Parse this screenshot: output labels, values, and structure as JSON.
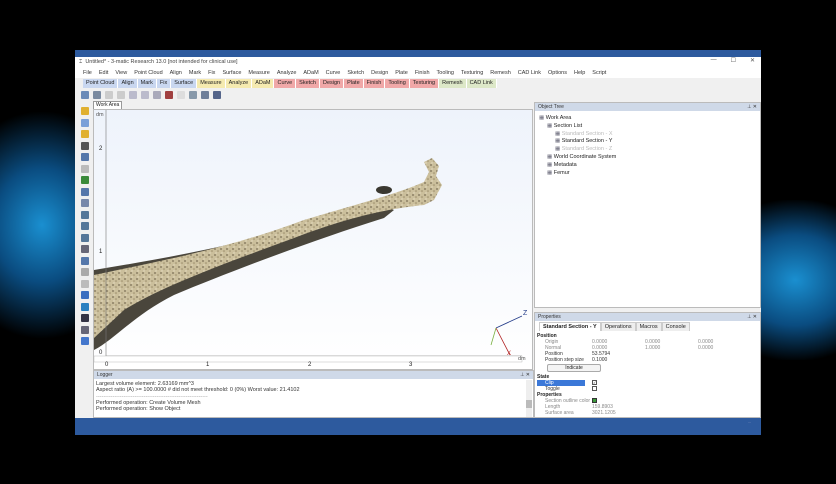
{
  "window": {
    "title": "Untitled* - 3-matic Research 13.0  [not intended for clinical use]",
    "controls": [
      "—",
      "☐",
      "✕"
    ]
  },
  "menu": [
    "File",
    "Edit",
    "View",
    "Point Cloud",
    "Align",
    "Mark",
    "Fix",
    "Surface",
    "Measure",
    "Analyze",
    "ADaM",
    "Curve",
    "Sketch",
    "Design",
    "Plate",
    "Finish",
    "Tooling",
    "Texturing",
    "Remesh",
    "CAD Link",
    "Options",
    "Help",
    "Script"
  ],
  "toolbar_tabs": [
    {
      "label": "Point Cloud",
      "color": "#c9d7f0"
    },
    {
      "label": "Align",
      "color": "#c9d7f0"
    },
    {
      "label": "Mark",
      "color": "#c9d7f0"
    },
    {
      "label": "Fix",
      "color": "#c9d7f0"
    },
    {
      "label": "Surface",
      "color": "#c9d7f0"
    },
    {
      "label": "Measure",
      "color": "#f5eab0"
    },
    {
      "label": "Analyze",
      "color": "#f5eab0"
    },
    {
      "label": "ADaM",
      "color": "#f5eab0"
    },
    {
      "label": "Curve",
      "color": "#f0a8a8"
    },
    {
      "label": "Sketch",
      "color": "#f0a8a8"
    },
    {
      "label": "Design",
      "color": "#f0a8a8"
    },
    {
      "label": "Plate",
      "color": "#f0a8a8"
    },
    {
      "label": "Finish",
      "color": "#f0a8a8"
    },
    {
      "label": "Tooling",
      "color": "#f0a8a8"
    },
    {
      "label": "Texturing",
      "color": "#f0a8a8"
    },
    {
      "label": "Remesh",
      "color": "#dde8c8"
    },
    {
      "label": "CAD Link",
      "color": "#dde8c8"
    }
  ],
  "viewport": {
    "tab": "Work Area",
    "unit": "dm",
    "y_ticks": [
      "2",
      "1",
      "0"
    ],
    "x_ticks": [
      "0",
      "1",
      "2",
      "3"
    ],
    "axes": {
      "z": "Z",
      "x": "X",
      "y": "Y"
    }
  },
  "object_tree": {
    "title": "Object Tree",
    "items": [
      {
        "label": "Work Area",
        "level": 0,
        "dim": false
      },
      {
        "label": "Section List",
        "level": 1,
        "dim": false
      },
      {
        "label": "Standard Section - X",
        "level": 2,
        "dim": true
      },
      {
        "label": "Standard Section - Y",
        "level": 2,
        "dim": false
      },
      {
        "label": "Standard Section - Z",
        "level": 2,
        "dim": true
      },
      {
        "label": "World Coordinate System",
        "level": 1,
        "dim": false
      },
      {
        "label": "Metadata",
        "level": 1,
        "dim": false
      },
      {
        "label": "Femur",
        "level": 1,
        "dim": false
      }
    ]
  },
  "properties": {
    "title": "Properties",
    "tabs": [
      "Standard Section - Y",
      "Operations",
      "Macros",
      "Console"
    ],
    "position_label": "Position",
    "origin": {
      "label": "Origin",
      "values": [
        "0.0000",
        "0.0000",
        "0.0000"
      ]
    },
    "normal": {
      "label": "Normal",
      "values": [
        "0.0000",
        "1.0000",
        "0.0000"
      ]
    },
    "position": {
      "label": "Position",
      "value": "53.5794"
    },
    "step": {
      "label": "Position step size",
      "value": "0.1000"
    },
    "indicate": "Indicate",
    "state_label": "State",
    "clip": "Clip",
    "toggle": "Toggle",
    "properties_label": "Properties",
    "outline": "Section outline color",
    "length": {
      "label": "Length",
      "value": "159.8903"
    },
    "surface": {
      "label": "Surface area",
      "value": "3021.1205"
    }
  },
  "logger": {
    "title": "Logger",
    "lines": [
      "Largest volume element: 2.63169 mm^3",
      "Aspect ratio (A) >= 100.0000    # did not meet threshold: 0 (0%)   Worst value: 21.4102",
      "-------------------------------------------------------------",
      "Performed operation: Create Volume Mesh",
      "Performed operation: Show Object"
    ]
  },
  "status": "..."
}
